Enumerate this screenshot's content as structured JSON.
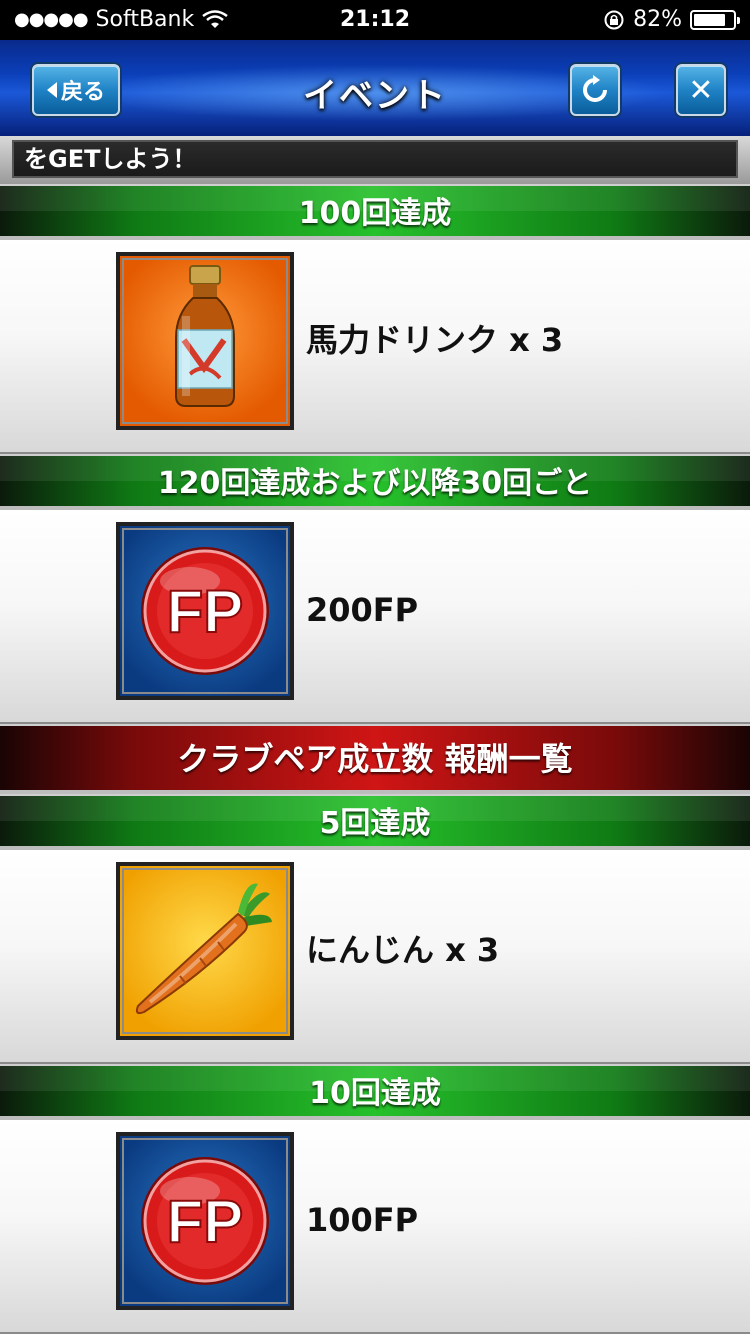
{
  "status_bar": {
    "signal_dots": "●●●●●",
    "carrier": "SoftBank",
    "time": "21:12",
    "battery_percent": "82%",
    "battery_level": 0.82
  },
  "header": {
    "back_label": "戻る",
    "title": "イベント",
    "close_glyph": "✕"
  },
  "ticker": {
    "text": "をGETしよう！"
  },
  "sections": {
    "s1_header": "100回達成",
    "s1_reward": "馬力ドリンク x 3",
    "s2_header": "120回達成および以降30回ごと",
    "s2_reward": "200FP",
    "club_header": "クラブペア成立数 報酬一覧",
    "s3_header": "5回達成",
    "s3_reward": "にんじん x 3",
    "s4_header": "10回達成",
    "s4_reward": "100FP"
  },
  "icons": {
    "drink": "drink-bottle-icon",
    "fp": "fp-coin-icon",
    "carrot": "carrot-icon"
  },
  "fp_icon_text": "FP"
}
